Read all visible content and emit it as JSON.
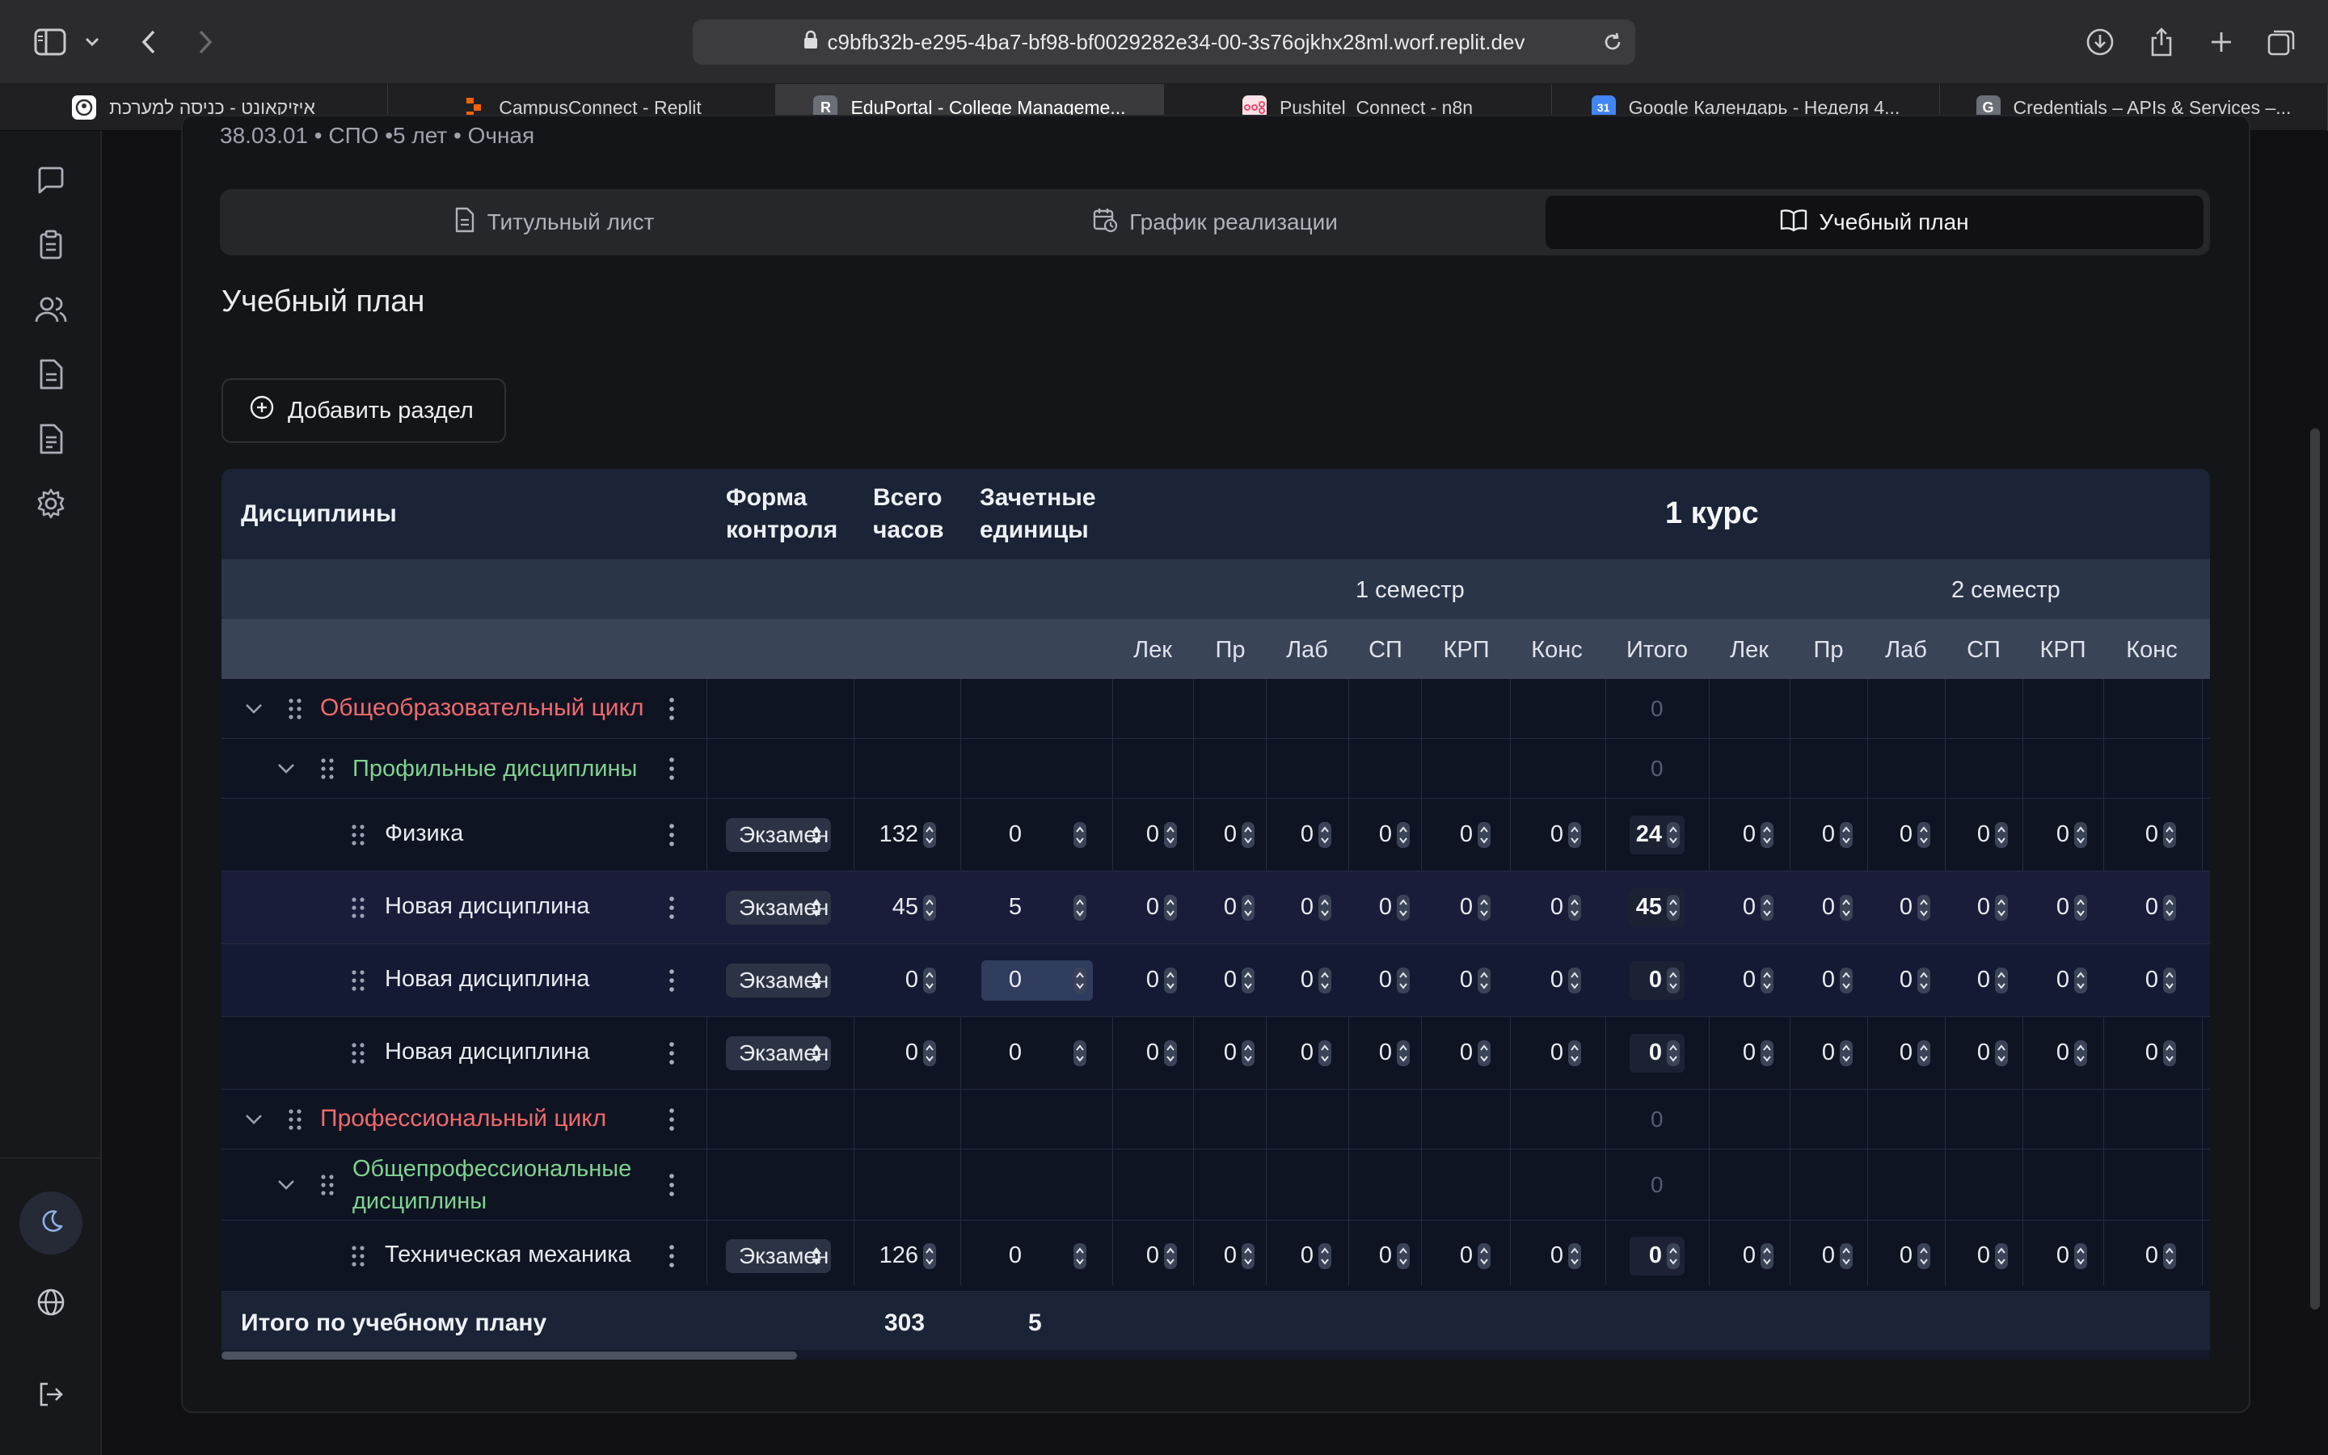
{
  "browser": {
    "url": "c9bfb32b-e295-4ba7-bf98-bf0029282e34-00-3s76ojkhx28ml.worf.replit.dev",
    "tabs": [
      {
        "label": "איזיקאונט - כניסה למערכת",
        "icon": "user-circle-icon",
        "color": "#ffffff"
      },
      {
        "label": "CampusConnect - Replit",
        "icon": "replit-icon",
        "color": "#f26207"
      },
      {
        "label": "EduPortal - College Manageme...",
        "icon": "letter-r-icon",
        "color": "#6b6f78",
        "letter": "R"
      },
      {
        "label": "Pushitel_Connect - n8n",
        "icon": "n8n-icon",
        "color": "#ea4b71"
      },
      {
        "label": "Google Календарь - Неделя 4...",
        "icon": "calendar-icon",
        "color": "#4285f4",
        "letter": "31"
      },
      {
        "label": "Credentials – APIs & Services –...",
        "icon": "letter-g-icon",
        "color": "#6b6f78",
        "letter": "G"
      }
    ]
  },
  "header": {
    "subtitle": "38.03.01 • СПО •5 лет • Очная",
    "tabs": [
      {
        "label": "Титульный лист",
        "icon": "document-icon"
      },
      {
        "label": "График реализации",
        "icon": "calendar-clock-icon"
      },
      {
        "label": "Учебный план",
        "icon": "book-open-icon"
      }
    ]
  },
  "page": {
    "title": "Учебный план",
    "add_section": "Добавить раздел"
  },
  "table": {
    "headers": {
      "disciplines": "Дисциплины",
      "control_form_1": "Форма",
      "control_form_2": "контроля",
      "total_hours_1": "Всего",
      "total_hours_2": "часов",
      "credits_1": "Зачетные",
      "credits_2": "единицы",
      "course": "1 курс",
      "semester1": "1 семестр",
      "semester2": "2 семестр"
    },
    "sub_columns": [
      "Лек",
      "Пр",
      "Лаб",
      "СП",
      "КРП",
      "Конс",
      "Итого",
      "Лек",
      "Пр",
      "Лаб",
      "СП",
      "КРП",
      "Конс"
    ],
    "rows": [
      {
        "kind": "cycle",
        "label": "Общеобразовательный цикл",
        "total": "0"
      },
      {
        "kind": "group",
        "label": "Профильные дисциплины",
        "total": "0"
      },
      {
        "kind": "discipline",
        "label": "Физика",
        "control": "Экзамен",
        "hours": "132",
        "credits": "0",
        "s1": [
          "0",
          "0",
          "0",
          "0",
          "0",
          "0"
        ],
        "s1_total": "24",
        "s2": [
          "0",
          "0",
          "0",
          "0",
          "0",
          "0"
        ]
      },
      {
        "kind": "discipline",
        "label": "Новая дисциплина",
        "control": "Экзамен",
        "hours": "45",
        "credits": "5",
        "s1": [
          "0",
          "0",
          "0",
          "0",
          "0",
          "0"
        ],
        "s1_total": "45",
        "s2": [
          "0",
          "0",
          "0",
          "0",
          "0",
          "0"
        ]
      },
      {
        "kind": "discipline",
        "label": "Новая дисциплина",
        "control": "Экзамен",
        "hours": "0",
        "credits": "0",
        "s1": [
          "0",
          "0",
          "0",
          "0",
          "0",
          "0"
        ],
        "s1_total": "0",
        "s2": [
          "0",
          "0",
          "0",
          "0",
          "0",
          "0"
        ]
      },
      {
        "kind": "discipline",
        "label": "Новая дисциплина",
        "control": "Экзамен",
        "hours": "0",
        "credits": "0",
        "s1": [
          "0",
          "0",
          "0",
          "0",
          "0",
          "0"
        ],
        "s1_total": "0",
        "s2": [
          "0",
          "0",
          "0",
          "0",
          "0",
          "0"
        ]
      },
      {
        "kind": "cycle",
        "label": "Профессиональный цикл",
        "total": "0"
      },
      {
        "kind": "group",
        "label": "Общепрофессиональные дисциплины",
        "label_line1": "Общепрофессиональные",
        "label_line2": "дисциплины",
        "total": "0"
      },
      {
        "kind": "discipline",
        "label": "Техническая механика",
        "control": "Экзамен",
        "hours": "126",
        "credits": "0",
        "s1": [
          "0",
          "0",
          "0",
          "0",
          "0",
          "0"
        ],
        "s1_total": "0",
        "s2": [
          "0",
          "0",
          "0",
          "0",
          "0",
          "0"
        ]
      }
    ],
    "footer": {
      "label": "Итого по учебному плану",
      "hours": "303",
      "credits": "5"
    }
  },
  "colors": {
    "cycle": "#ef6a6a",
    "group": "#7fd38f",
    "accent": "#2f3c5d"
  }
}
